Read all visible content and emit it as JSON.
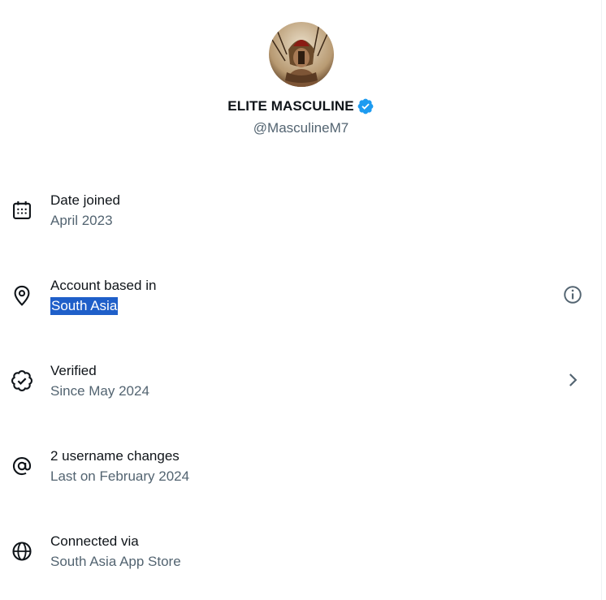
{
  "profile": {
    "display_name": "ELITE MASCULINE",
    "handle": "@MasculineM7",
    "verified_badge_color": "#1d9bf0"
  },
  "rows": [
    {
      "label": "Date joined",
      "value": "April 2023",
      "icon": "calendar-icon"
    },
    {
      "label": "Account based in",
      "value": "South Asia",
      "icon": "location-pin-icon",
      "action_icon": "info-icon",
      "value_selected": true
    },
    {
      "label": "Verified",
      "value": "Since May 2024",
      "icon": "verified-check-icon",
      "action_icon": "chevron-right-icon"
    },
    {
      "label": "2 username changes",
      "value": "Last on February 2024",
      "icon": "at-sign-icon"
    },
    {
      "label": "Connected via",
      "value": "South Asia App Store",
      "icon": "globe-icon"
    }
  ],
  "colors": {
    "text_primary": "#0f1419",
    "text_secondary": "#536471",
    "selection": "#1f5fc9"
  }
}
